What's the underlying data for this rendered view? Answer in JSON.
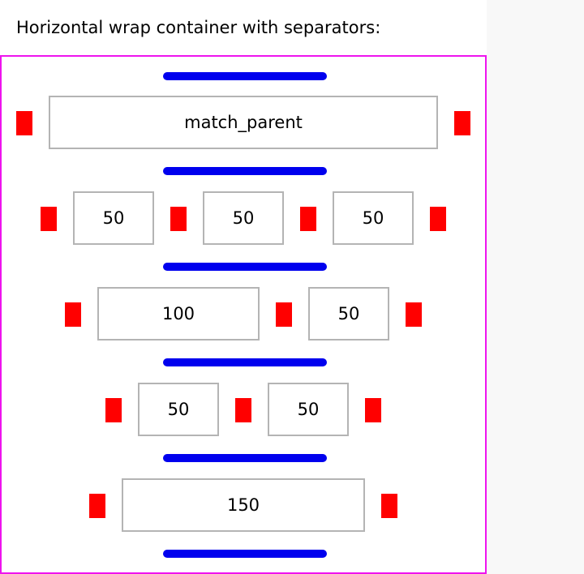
{
  "title": "Horizontal wrap container with separators:",
  "rows": [
    {
      "items": [
        "match_parent"
      ]
    },
    {
      "items": [
        "50",
        "50",
        "50"
      ]
    },
    {
      "items": [
        "100",
        "50"
      ]
    },
    {
      "items": [
        "50",
        "50"
      ]
    },
    {
      "items": [
        "150"
      ]
    }
  ],
  "colors": {
    "container_border": "#ee14ee",
    "line_separator": "#0000ee",
    "item_separator": "#ff0000",
    "item_border": "#b4b4b4"
  }
}
